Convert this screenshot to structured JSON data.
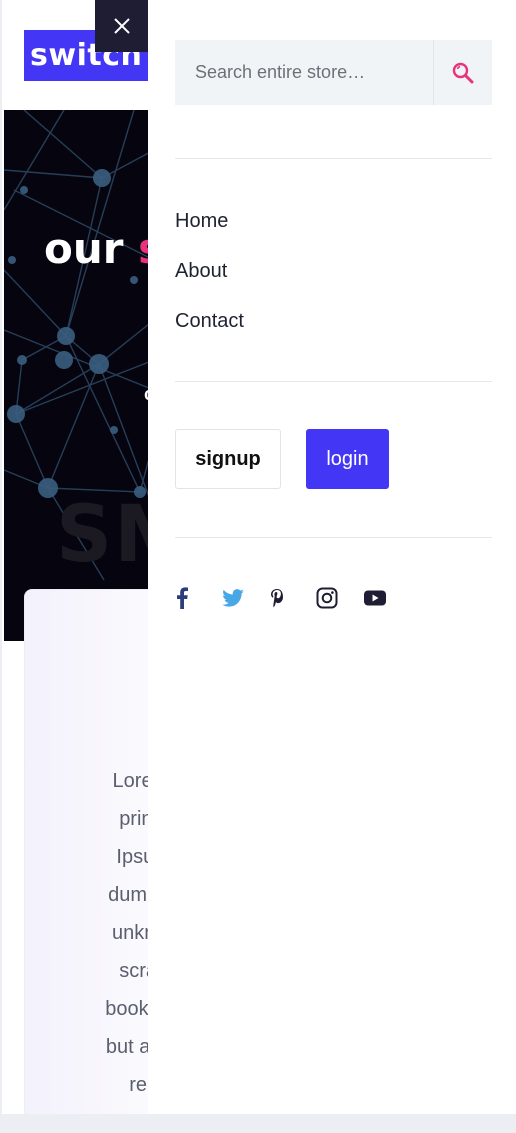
{
  "page": {
    "logo_text": "switch m",
    "hero_title_plain": "our ",
    "hero_title_accent": "s",
    "hero_sub1": "c",
    "hero_sub2": "l",
    "hero_ghost": "SM",
    "card_text": "Lorem Ip printing Ipsum h dummy te unknown scramb book. It ha but also th rema",
    "card_lines": [
      "Lorem Ip",
      "printing",
      "Ipsum h",
      "dummy te",
      "unknown",
      "scramb",
      "book. It ha",
      "but also th",
      "rema"
    ]
  },
  "drawer": {
    "search": {
      "placeholder": "Search entire store…",
      "value": ""
    },
    "nav": [
      {
        "label": "Home"
      },
      {
        "label": "About"
      },
      {
        "label": "Contact"
      }
    ],
    "signup_label": "signup",
    "login_label": "login",
    "social": [
      "facebook-icon",
      "twitter-icon",
      "pinterest-icon",
      "instagram-icon",
      "youtube-icon"
    ]
  },
  "colors": {
    "brand": "#4337f5",
    "accent": "#e8327c",
    "dark": "#1e1d33",
    "twitter": "#4aa7e6",
    "facebook": "#2c3e7a"
  }
}
